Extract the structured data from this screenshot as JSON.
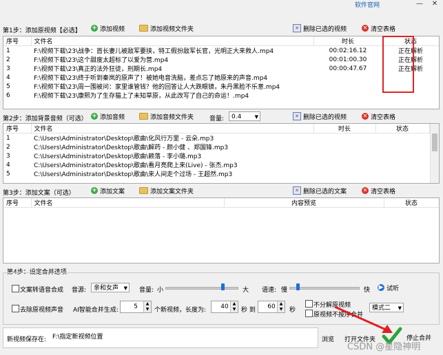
{
  "window": {
    "link": "软件官网",
    "minimize": "—",
    "close": "✕"
  },
  "step1": {
    "label": "第1步：添加原视频【必选】",
    "add_video": "添加视频",
    "add_folder": "添加视频文件夹",
    "delete_selected": "删除已选的视频",
    "clear_table": "清空表格",
    "columns": [
      "序号",
      "文件名",
      "时长",
      "状态"
    ],
    "rows": [
      [
        "1",
        "F:\\视频下载\\23\\战争：首长妻儿被敌军要挟，特工假扮敌军长官，光明正大来救人.mp4",
        "00:02:16.12",
        "正在解析"
      ],
      [
        "2",
        "F:\\视频下载\\23\\这个甜度太超标了以爱为营.mp4",
        "00:01:00.30",
        "正在解析"
      ],
      [
        "3",
        "F:\\视频下载\\23\\真正的法外狂徒，刑期长.mp4",
        "00:00:47.67",
        "正在解析"
      ],
      [
        "4",
        "F:\\视频下载\\23\\终于听到秦岚的原声了！被她电音洗脑，差点忘了她原来的声音.mp4",
        "",
        ""
      ],
      [
        "5",
        "F:\\视频下载\\23\\周一围被问：家里谁管钱？他的回答让人大跌眼镜，朱丹黑脸不乐意.mp4",
        "",
        ""
      ],
      [
        "6",
        "F:\\视频下载\\23\\康熙为了生存猫上了未知草原，从此改写了自己的命运！.mp4",
        "",
        ""
      ]
    ]
  },
  "step2": {
    "label": "第2步：添加背景音频（可选）",
    "add_audio": "添加音频",
    "add_folder": "添加音频文件夹",
    "volume_label": "音量:",
    "volume_value": "0.4",
    "delete_selected": "删除已选的视频",
    "clear_table": "清空表格",
    "columns": [
      "序号",
      "文件名",
      "时长",
      "状态"
    ],
    "rows": [
      [
        "1",
        "C:\\Users\\Administrator\\Desktop\\歌曲\\化风行万里 - 云朵.mp3",
        "",
        ""
      ],
      [
        "2",
        "C:\\Users\\Administrator\\Desktop\\歌曲\\解药 - 颜小健 、郑国锋.mp3",
        "",
        ""
      ],
      [
        "3",
        "C:\\Users\\Administrator\\Desktop\\歌曲\\赖落 - 李小璐.mp3",
        "",
        ""
      ],
      [
        "4",
        "C:\\Users\\Administrator\\Desktop\\歌曲\\看月亮爬上来(Live) - 张杰.mp3",
        "",
        ""
      ],
      [
        "5",
        "C:\\Users\\Administrator\\Desktop\\歌曲\\来人间走个过场 - 王超然.mp3",
        "",
        ""
      ]
    ]
  },
  "step3": {
    "label": "第3步：添加文案（可选）",
    "add_text": "添加文案",
    "add_folder": "添加文案文件夹",
    "delete_selected": "删除已选的文案",
    "clear_table": "清空表格",
    "columns": [
      "序号",
      "文件名",
      "内容预览",
      "状态"
    ]
  },
  "step4": {
    "label": "第4步：设定合并选项",
    "tts_label": "文案转语音合成",
    "voice_label": "音源:",
    "voice_value": "亲和女声",
    "volume_label": "音量:",
    "small": "小",
    "large": "大",
    "speed_label": "语速:",
    "slow": "慢",
    "fast": "快",
    "listen": "试听",
    "remove_audio": "去除原视频声音",
    "ai_label": "AI智能合并生成:",
    "count_value": "5",
    "count_suffix": "个新视频，长度为:",
    "len_from": "40",
    "sec_to": "秒 到",
    "len_to": "60",
    "sec": "秒",
    "opt_no_split": "不分解原视频",
    "opt_sequential": "原视频不按序合并",
    "mode_value": "模式二"
  },
  "save": {
    "label": "新视频保存在:",
    "path": "F:\\指定新视频位置",
    "browse": "浏览",
    "open_folder": "打开文件夹",
    "stop": "停止合并"
  },
  "watermark": "CSDN @星隐神明",
  "colors": {
    "highlight": "#e02020",
    "accent_blue": "#1e70d6"
  }
}
